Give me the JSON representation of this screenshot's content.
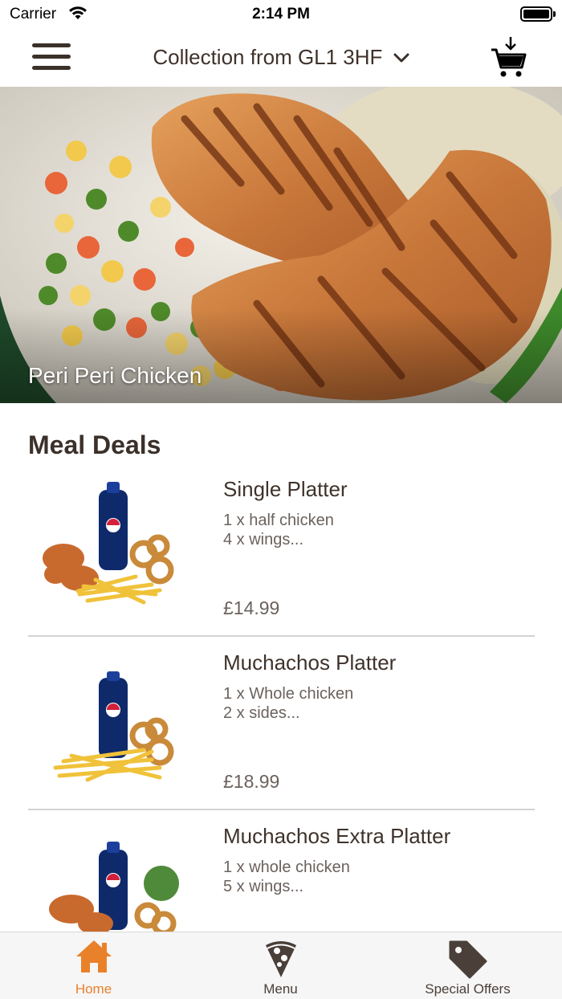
{
  "status_bar": {
    "carrier": "Carrier",
    "time": "2:14 PM"
  },
  "nav": {
    "location": "Collection from GL1 3HF",
    "menu_icon": "hamburger-icon",
    "cart_icon": "cart-icon"
  },
  "hero": {
    "caption": "Peri Peri Chicken"
  },
  "section": {
    "title": "Meal Deals"
  },
  "deals": [
    {
      "name": "Single Platter",
      "desc_line1": "1 x half chicken",
      "desc_line2": "4 x wings...",
      "price": "£14.99"
    },
    {
      "name": "Muchachos Platter",
      "desc_line1": "1 x Whole chicken",
      "desc_line2": "2 x sides...",
      "price": "£18.99"
    },
    {
      "name": "Muchachos Extra Platter",
      "desc_line1": "1 x whole chicken",
      "desc_line2": "5 x wings...",
      "price": ""
    }
  ],
  "tabs": [
    {
      "label": "Home",
      "icon": "home-icon",
      "active": true
    },
    {
      "label": "Menu",
      "icon": "pizza-slice-icon",
      "active": false
    },
    {
      "label": "Special Offers",
      "icon": "tag-icon",
      "active": false
    }
  ],
  "colors": {
    "accent": "#e9812b",
    "text": "#3f322b",
    "tab_inactive": "#4a3f39",
    "divider": "#d5d3d1"
  }
}
